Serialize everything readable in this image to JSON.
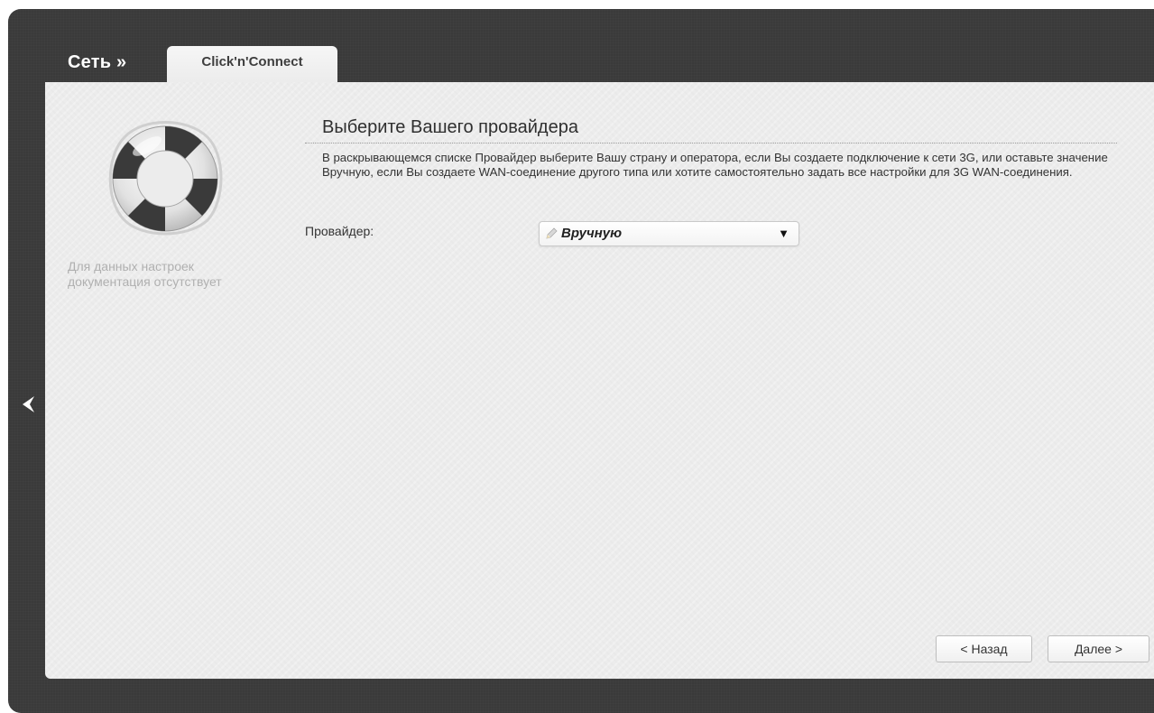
{
  "header": {
    "breadcrumb": "Сеть »",
    "tab_label": "Click'n'Connect"
  },
  "sidebar": {
    "icon": "lifebuoy-icon",
    "help_text": "Для данных настроек документация отсутствует"
  },
  "main": {
    "title": "Выберите Вашего провайдера",
    "description": "В раскрывающемся списке Провайдер выберите Вашу страну и оператора, если Вы создаете подключение к сети 3G, или оставьте значение Вручную, если Вы создаете WAN-соединение другого типа или хотите самостоятельно задать все настройки для 3G WAN-соединения.",
    "provider_label": "Провайдер:",
    "provider_value": "Вручную"
  },
  "footer": {
    "back_label": "< Назад",
    "next_label": "Далее >"
  },
  "colors": {
    "frame": "#3a3a3a",
    "content": "#ececec",
    "help_text": "#b0b0b0"
  }
}
